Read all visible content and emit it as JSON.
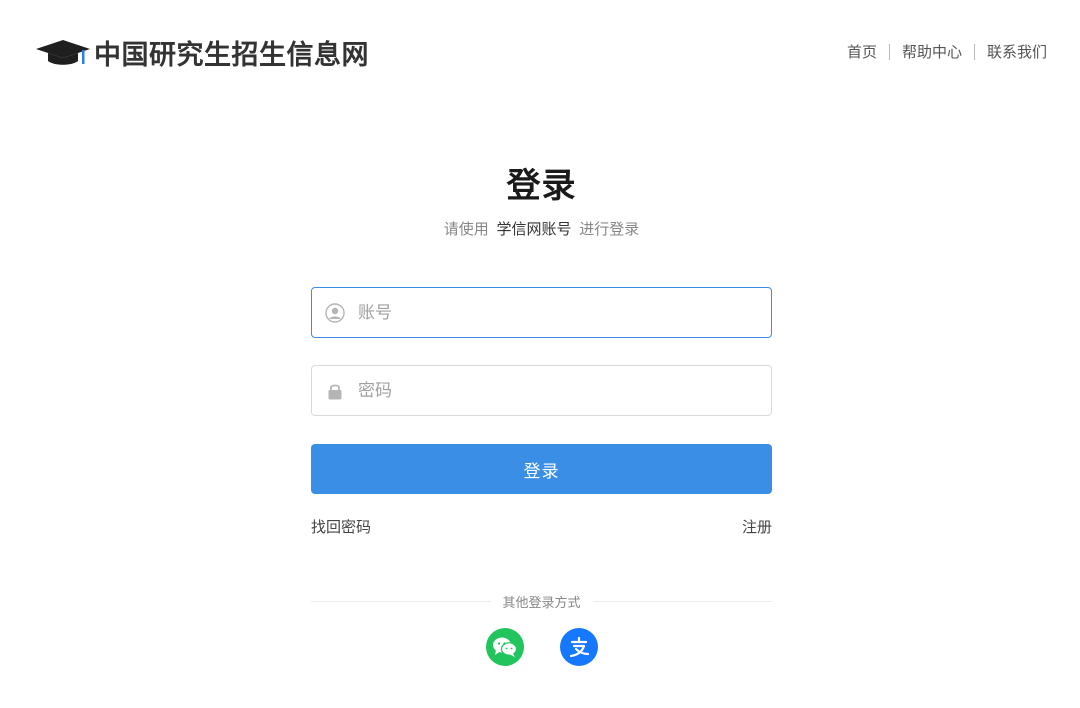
{
  "header": {
    "site_name": "中国研究生招生信息网",
    "nav": [
      "首页",
      "帮助中心",
      "联系我们"
    ]
  },
  "login": {
    "title": "登录",
    "subtitle_prefix": "请使用",
    "subtitle_brand": "学信网账号",
    "subtitle_suffix": "进行登录",
    "account_placeholder": "账号",
    "password_placeholder": "密码",
    "submit_label": "登录",
    "forgot_label": "找回密码",
    "register_label": "注册",
    "other_methods_label": "其他登录方式"
  },
  "social": {
    "wechat_icon": "wechat-icon",
    "alipay_icon": "alipay-icon"
  },
  "colors": {
    "accent": "#3a8ee6",
    "wechat": "#22c45e",
    "alipay": "#1677ff"
  }
}
